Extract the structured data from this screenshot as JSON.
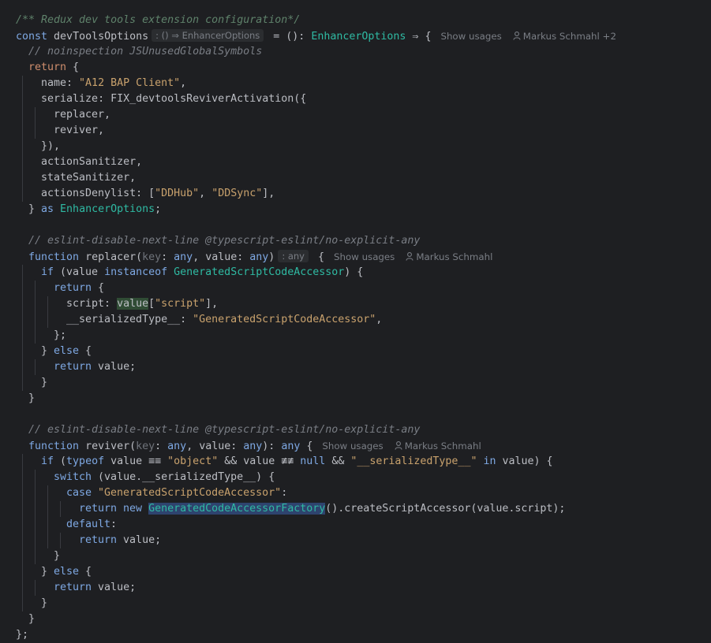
{
  "editor": {
    "lines": [
      {
        "indent": 0,
        "tokens": [
          {
            "t": "/** Redux dev tools extension configuration*/",
            "c": "doc"
          }
        ]
      },
      {
        "indent": 0,
        "tokens": [
          {
            "t": "const ",
            "c": "kwb"
          },
          {
            "t": "devToolsOptions",
            "c": "var"
          },
          {
            "t": ": () ⇒ EnhancerOptions",
            "c": "hint"
          },
          {
            "t": " = (): ",
            "c": "var"
          },
          {
            "t": "EnhancerOptions",
            "c": "type"
          },
          {
            "t": " ⇒ {",
            "c": "var"
          }
        ],
        "lens": {
          "usages": "Show usages",
          "author": "Markus Schmahl +2"
        }
      },
      {
        "indent": 1,
        "tokens": [
          {
            "t": "// noinspection JSUnusedGlobalSymbols",
            "c": "cmt"
          }
        ]
      },
      {
        "indent": 1,
        "tokens": [
          {
            "t": "return",
            "c": "kw"
          },
          {
            "t": " {",
            "c": "var"
          }
        ]
      },
      {
        "indent": 2,
        "tokens": [
          {
            "t": "name",
            "c": "var"
          },
          {
            "t": ": ",
            "c": "var"
          },
          {
            "t": "\"A12 BAP Client\"",
            "c": "strw"
          },
          {
            "t": ",",
            "c": "var"
          }
        ]
      },
      {
        "indent": 2,
        "tokens": [
          {
            "t": "serialize",
            "c": "var"
          },
          {
            "t": ": FIX_devtoolsReviverActivation({",
            "c": "var"
          }
        ]
      },
      {
        "indent": 3,
        "tokens": [
          {
            "t": "replacer,",
            "c": "var"
          }
        ]
      },
      {
        "indent": 3,
        "tokens": [
          {
            "t": "reviver,",
            "c": "var"
          }
        ]
      },
      {
        "indent": 2,
        "tokens": [
          {
            "t": "}),",
            "c": "var"
          }
        ]
      },
      {
        "indent": 2,
        "tokens": [
          {
            "t": "actionSanitizer,",
            "c": "var"
          }
        ]
      },
      {
        "indent": 2,
        "tokens": [
          {
            "t": "stateSanitizer,",
            "c": "var"
          }
        ]
      },
      {
        "indent": 2,
        "tokens": [
          {
            "t": "actionsDenylist",
            "c": "var"
          },
          {
            "t": ": [",
            "c": "var"
          },
          {
            "t": "\"DDHub\"",
            "c": "strw"
          },
          {
            "t": ", ",
            "c": "var"
          },
          {
            "t": "\"DDSync\"",
            "c": "strw"
          },
          {
            "t": "],",
            "c": "var"
          }
        ]
      },
      {
        "indent": 1,
        "tokens": [
          {
            "t": "} ",
            "c": "var"
          },
          {
            "t": "as ",
            "c": "kwb"
          },
          {
            "t": "EnhancerOptions",
            "c": "type"
          },
          {
            "t": ";",
            "c": "var"
          }
        ]
      },
      {
        "indent": 0,
        "tokens": []
      },
      {
        "indent": 1,
        "tokens": [
          {
            "t": "// eslint-disable-next-line @typescript-eslint/no-explicit-any",
            "c": "cmt"
          }
        ]
      },
      {
        "indent": 1,
        "tokens": [
          {
            "t": "function ",
            "c": "kwb"
          },
          {
            "t": "replacer",
            "c": "var"
          },
          {
            "t": "(",
            "c": "var"
          },
          {
            "t": "key",
            "c": "param-hint"
          },
          {
            "t": ": ",
            "c": "var"
          },
          {
            "t": "any",
            "c": "kwb"
          },
          {
            "t": ", ",
            "c": "var"
          },
          {
            "t": "value",
            "c": "var"
          },
          {
            "t": ": ",
            "c": "var"
          },
          {
            "t": "any",
            "c": "kwb"
          },
          {
            "t": ")",
            "c": "var"
          },
          {
            "t": ": any",
            "c": "hint"
          },
          {
            "t": " {",
            "c": "var"
          }
        ],
        "lens": {
          "usages": "Show usages",
          "author": "Markus Schmahl"
        }
      },
      {
        "indent": 2,
        "tokens": [
          {
            "t": "if ",
            "c": "kwb"
          },
          {
            "t": "(value ",
            "c": "var"
          },
          {
            "t": "instanceof ",
            "c": "kwb"
          },
          {
            "t": "GeneratedScriptCodeAccessor",
            "c": "type"
          },
          {
            "t": ") {",
            "c": "var"
          }
        ]
      },
      {
        "indent": 3,
        "tokens": [
          {
            "t": "return",
            "c": "kwb"
          },
          {
            "t": " {",
            "c": "var"
          }
        ]
      },
      {
        "indent": 4,
        "tokens": [
          {
            "t": "script",
            "c": "var"
          },
          {
            "t": ": ",
            "c": "var"
          },
          {
            "t": "value",
            "c": "hl-use"
          },
          {
            "t": "[",
            "c": "var"
          },
          {
            "t": "\"script\"",
            "c": "strw"
          },
          {
            "t": "],",
            "c": "var"
          }
        ]
      },
      {
        "indent": 4,
        "tokens": [
          {
            "t": "__serializedType__",
            "c": "var"
          },
          {
            "t": ": ",
            "c": "var"
          },
          {
            "t": "\"GeneratedScriptCodeAccessor\"",
            "c": "strw"
          },
          {
            "t": ",",
            "c": "var"
          }
        ]
      },
      {
        "indent": 3,
        "tokens": [
          {
            "t": "};",
            "c": "var"
          }
        ]
      },
      {
        "indent": 2,
        "tokens": [
          {
            "t": "} ",
            "c": "var"
          },
          {
            "t": "else",
            "c": "kwb"
          },
          {
            "t": " {",
            "c": "var"
          }
        ]
      },
      {
        "indent": 3,
        "tokens": [
          {
            "t": "return ",
            "c": "kwb"
          },
          {
            "t": "value;",
            "c": "var"
          }
        ]
      },
      {
        "indent": 2,
        "tokens": [
          {
            "t": "}",
            "c": "var"
          }
        ]
      },
      {
        "indent": 1,
        "tokens": [
          {
            "t": "}",
            "c": "var"
          }
        ]
      },
      {
        "indent": 0,
        "tokens": []
      },
      {
        "indent": 1,
        "tokens": [
          {
            "t": "// eslint-disable-next-line @typescript-eslint/no-explicit-any",
            "c": "cmt"
          }
        ]
      },
      {
        "indent": 1,
        "tokens": [
          {
            "t": "function ",
            "c": "kwb"
          },
          {
            "t": "reviver",
            "c": "var"
          },
          {
            "t": "(",
            "c": "var"
          },
          {
            "t": "key",
            "c": "param-hint"
          },
          {
            "t": ": ",
            "c": "var"
          },
          {
            "t": "any",
            "c": "kwb"
          },
          {
            "t": ", ",
            "c": "var"
          },
          {
            "t": "value",
            "c": "var"
          },
          {
            "t": ": ",
            "c": "var"
          },
          {
            "t": "any",
            "c": "kwb"
          },
          {
            "t": "): ",
            "c": "var"
          },
          {
            "t": "any",
            "c": "kwb"
          },
          {
            "t": " {",
            "c": "var"
          }
        ],
        "lens": {
          "usages": "Show usages",
          "author": "Markus Schmahl"
        }
      },
      {
        "indent": 2,
        "tokens": [
          {
            "t": "if ",
            "c": "kwb"
          },
          {
            "t": "(",
            "c": "var"
          },
          {
            "t": "typeof ",
            "c": "kwb"
          },
          {
            "t": "value ≡≡ ",
            "c": "var"
          },
          {
            "t": "\"object\"",
            "c": "strw"
          },
          {
            "t": " && value ≢≢ ",
            "c": "var"
          },
          {
            "t": "null",
            "c": "kwb"
          },
          {
            "t": " && ",
            "c": "var"
          },
          {
            "t": "\"__serializedType__\"",
            "c": "strw"
          },
          {
            "t": " in ",
            "c": "kwb"
          },
          {
            "t": "value) {",
            "c": "var"
          }
        ]
      },
      {
        "indent": 3,
        "tokens": [
          {
            "t": "switch ",
            "c": "kwb"
          },
          {
            "t": "(value.__serializedType__) {",
            "c": "var"
          }
        ]
      },
      {
        "indent": 4,
        "tokens": [
          {
            "t": "case ",
            "c": "kwb"
          },
          {
            "t": "\"GeneratedScriptCodeAccessor\"",
            "c": "strw"
          },
          {
            "t": ":",
            "c": "var"
          }
        ]
      },
      {
        "indent": 5,
        "tokens": [
          {
            "t": "return ",
            "c": "kwb"
          },
          {
            "t": "new ",
            "c": "kwb"
          },
          {
            "t": "GeneratedCodeAccessorFactory",
            "c": "hl-cls-type"
          },
          {
            "t": "().createScriptAccessor(value.script);",
            "c": "var"
          }
        ]
      },
      {
        "indent": 4,
        "tokens": [
          {
            "t": "default",
            "c": "kwb"
          },
          {
            "t": ":",
            "c": "var"
          }
        ]
      },
      {
        "indent": 5,
        "tokens": [
          {
            "t": "return ",
            "c": "kwb"
          },
          {
            "t": "value;",
            "c": "var"
          }
        ]
      },
      {
        "indent": 3,
        "tokens": [
          {
            "t": "}",
            "c": "var"
          }
        ]
      },
      {
        "indent": 2,
        "tokens": [
          {
            "t": "} ",
            "c": "var"
          },
          {
            "t": "else",
            "c": "kwb"
          },
          {
            "t": " {",
            "c": "var"
          }
        ]
      },
      {
        "indent": 3,
        "tokens": [
          {
            "t": "return ",
            "c": "kwb"
          },
          {
            "t": "value;",
            "c": "var"
          }
        ]
      },
      {
        "indent": 2,
        "tokens": [
          {
            "t": "}",
            "c": "var"
          }
        ]
      },
      {
        "indent": 1,
        "tokens": [
          {
            "t": "}",
            "c": "var"
          }
        ]
      },
      {
        "indent": 0,
        "tokens": [
          {
            "t": "};",
            "c": "var"
          }
        ]
      }
    ]
  },
  "colors": {
    "background": "#1e1f22",
    "keyword": "#7ea8e3",
    "string": "#c9a26d",
    "type": "#2fbaa3",
    "comment": "#7a7e85",
    "doc_comment": "#5f826b"
  }
}
